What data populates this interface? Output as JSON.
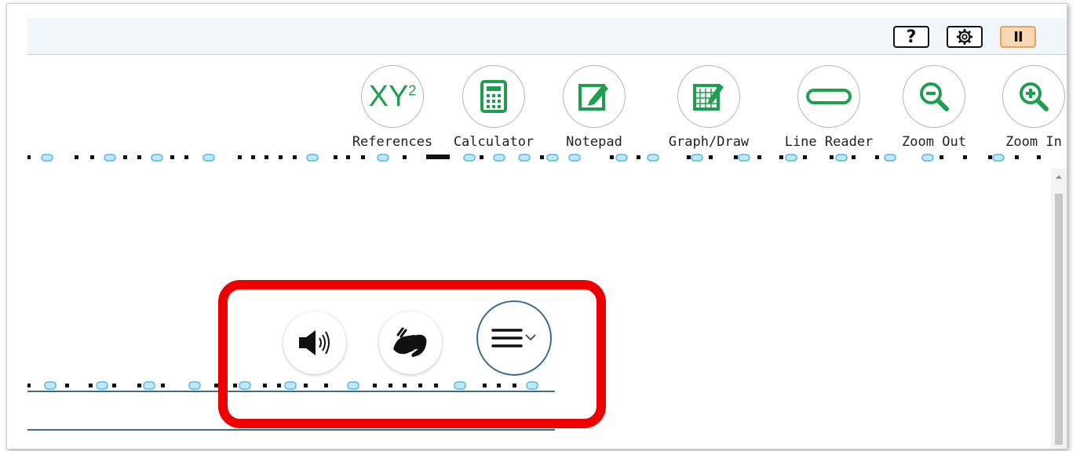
{
  "header": {
    "help_label": "?",
    "settings_icon": "gear-icon",
    "pause_label": "II"
  },
  "toolbar": {
    "tools": [
      {
        "label": "References",
        "icon": "references-icon"
      },
      {
        "label": "Calculator",
        "icon": "calculator-icon"
      },
      {
        "label": "Notepad",
        "icon": "notepad-icon"
      },
      {
        "label": "Graph/Draw",
        "icon": "graph-draw-icon"
      },
      {
        "label": "Line Reader",
        "icon": "line-reader-icon"
      },
      {
        "label": "Zoom Out",
        "icon": "zoom-out-icon"
      },
      {
        "label": "Zoom In",
        "icon": "zoom-in-icon"
      }
    ],
    "references_glyph": "XY",
    "references_sup": "2"
  },
  "floating_tools": {
    "speaker_icon": "speaker-icon",
    "sign_language_icon": "sign-language-icon",
    "menu_icon": "hamburger-dropdown-icon"
  },
  "colors": {
    "accent_green": "#1e9e4f",
    "highlight_red": "#ee0000",
    "menu_border": "#3b6e91",
    "focus_dot": "#7fd4f3"
  }
}
